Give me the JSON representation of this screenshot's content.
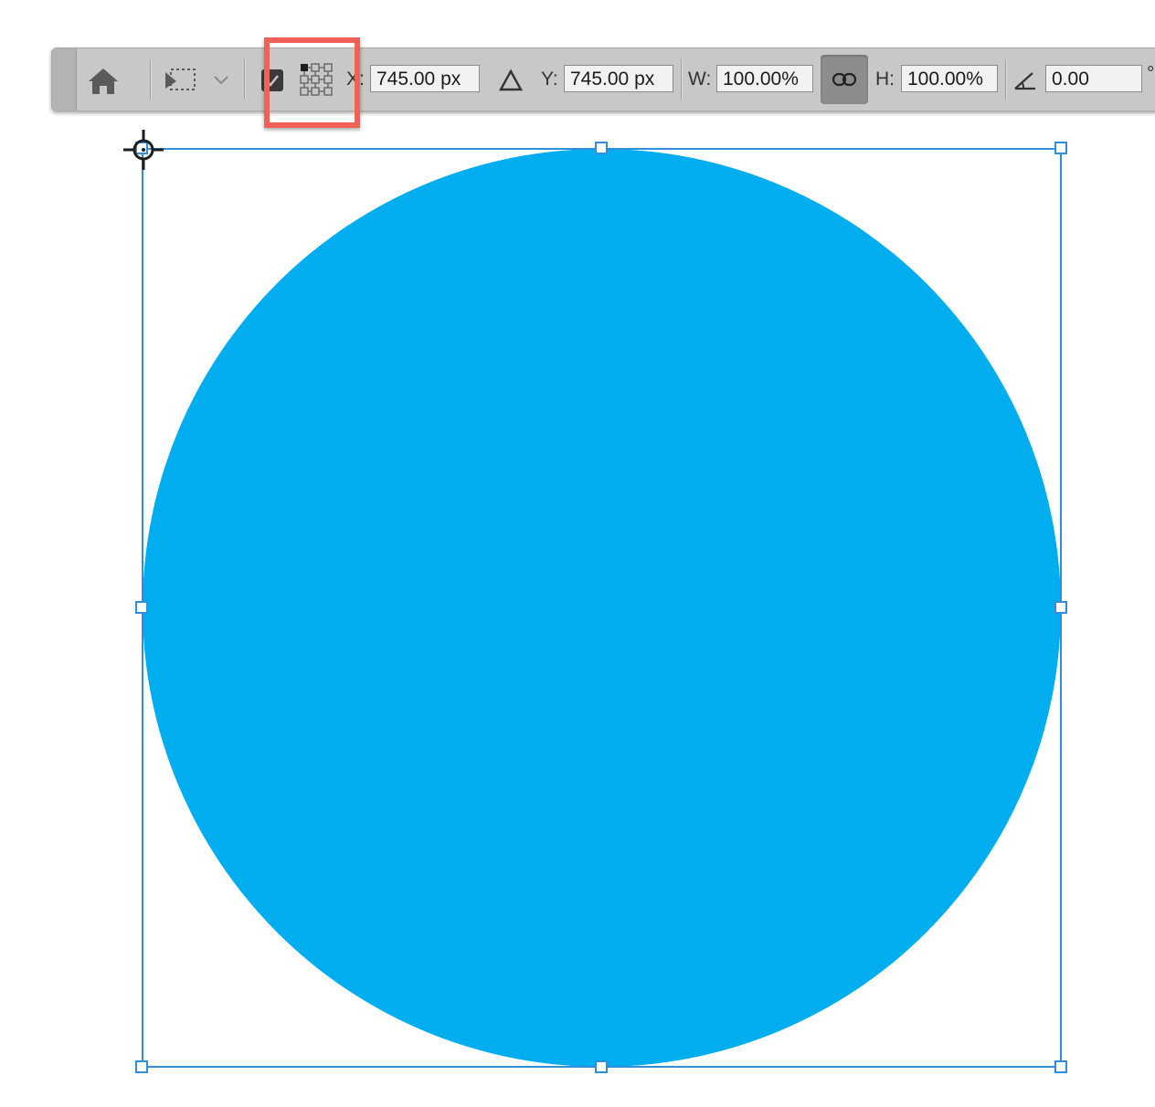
{
  "toolbar": {
    "x_label": "X:",
    "x_value": "745.00 px",
    "y_label": "Y:",
    "y_value": "745.00 px",
    "w_label": "W:",
    "w_value": "100.00%",
    "h_label": "H:",
    "h_value": "100.00%",
    "angle_value": "0.00",
    "angle_unit": "°",
    "icons": {
      "home": "home-icon",
      "transform": "transform-selection-icon",
      "dropdown": "chevron-down-icon",
      "reference_toggle": "reference-point-toggle-icon",
      "reference_grid": "reference-point-grid-icon",
      "delta": "relative-position-delta-icon",
      "link": "link-icon",
      "angle": "rotation-angle-icon"
    }
  },
  "canvas": {
    "shape": "circle",
    "fill_color": "#00aeef",
    "bbox_color": "#2f8fdc",
    "reference_icon": "reference-point-crosshair-icon"
  },
  "annotation": {
    "highlight_color": "#f26157"
  }
}
